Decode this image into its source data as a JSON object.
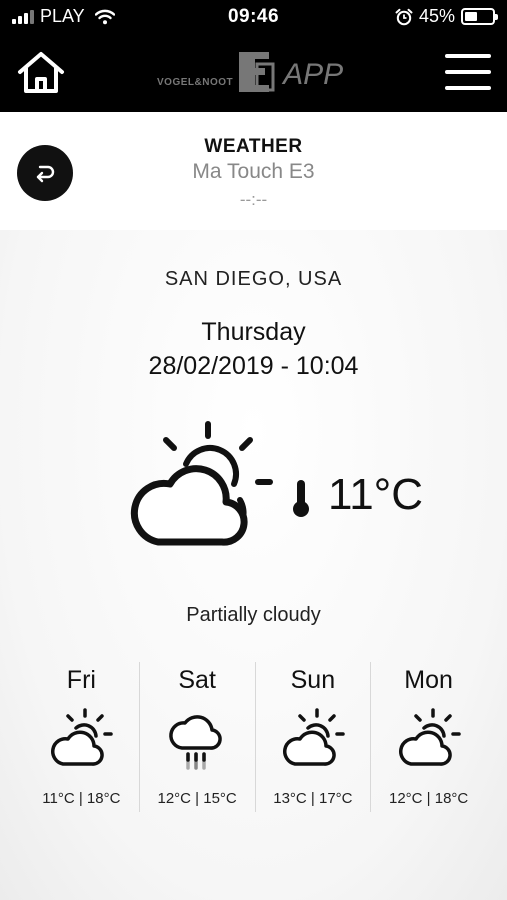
{
  "status_bar": {
    "carrier": "PLAY",
    "time": "09:46",
    "battery_percent": "45%",
    "battery_level": 0.45,
    "icons": [
      "signal-icon",
      "wifi-icon",
      "alarm-icon",
      "battery-icon"
    ]
  },
  "app_header": {
    "brand_small": "VOGEL&NOOT",
    "brand_app": "APP",
    "icons": [
      "home-icon",
      "brand-logo",
      "hamburger-menu-icon"
    ]
  },
  "title_bar": {
    "title": "WEATHER",
    "subtitle": "Ma Touch E3",
    "time": "--:--",
    "back_icon": "back-arrow-icon"
  },
  "weather": {
    "location": "SAN DIEGO, USA",
    "day": "Thursday",
    "datetime": "28/02/2019 - 10:04",
    "icon": "partly-cloudy-icon",
    "temperature": "11°C",
    "condition": "Partially cloudy"
  },
  "forecast": [
    {
      "day": "Fri",
      "icon": "partly-cloudy-icon",
      "temps": "11°C | 18°C"
    },
    {
      "day": "Sat",
      "icon": "rain-cloud-icon",
      "temps": "12°C | 15°C"
    },
    {
      "day": "Sun",
      "icon": "partly-cloudy-icon",
      "temps": "13°C | 17°C"
    },
    {
      "day": "Mon",
      "icon": "partly-cloudy-icon",
      "temps": "12°C | 18°C"
    }
  ]
}
